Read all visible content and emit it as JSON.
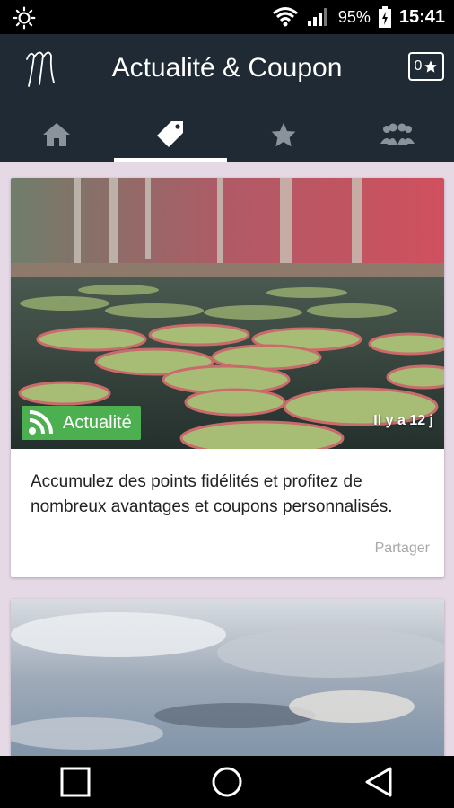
{
  "status_bar": {
    "battery": "95%",
    "time": "15:41"
  },
  "app_bar": {
    "title": "Actualité & Coupon",
    "badge_count": "0"
  },
  "tabs": [
    {
      "id": "home",
      "icon": "home-icon",
      "active": false
    },
    {
      "id": "tags",
      "icon": "tag-icon",
      "active": true
    },
    {
      "id": "favorites",
      "icon": "star-icon",
      "active": false
    },
    {
      "id": "community",
      "icon": "group-icon",
      "active": false
    }
  ],
  "cards": [
    {
      "label": "Actualité",
      "date": "Il y a 12 j",
      "text": "Accumulez des points fidélités et profitez de nombreux avantages et coupons personnalisés.",
      "share": "Partager"
    }
  ],
  "colors": {
    "app_bar": "#1f2a34",
    "background": "#e6d9e6",
    "news_badge": "#4caf50"
  }
}
